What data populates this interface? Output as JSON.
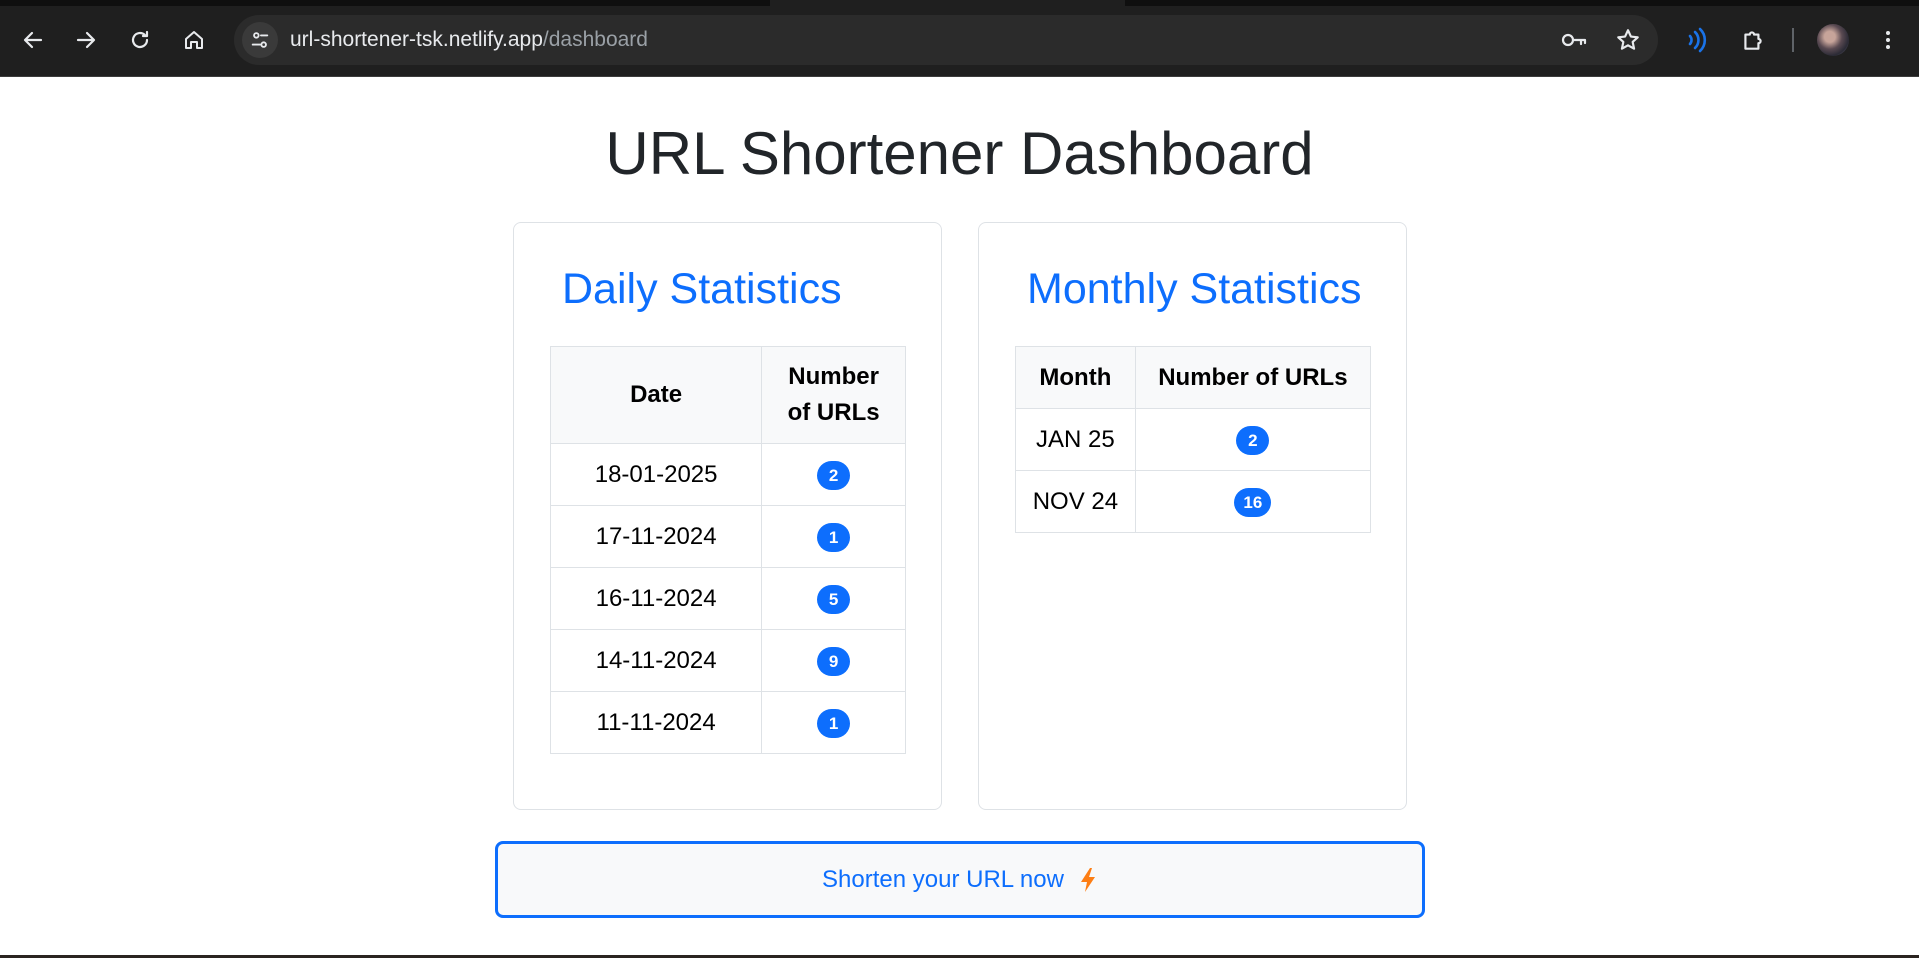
{
  "browser": {
    "url_host": "url-shortener-tsk.netlify.app",
    "url_path": "/dashboard",
    "icons": {
      "back": "arrow-left-icon",
      "forward": "arrow-right-icon",
      "reload": "reload-icon",
      "home": "home-icon",
      "site_info": "tune-icon",
      "password": "key-icon",
      "bookmark": "star-icon",
      "media": "broadcast-icon",
      "extensions": "puzzle-icon",
      "menu": "kebab-menu-icon"
    },
    "colors": {
      "chrome_bg": "#1f1f1f",
      "omnibox_bg": "#2b2b2b",
      "media_accent": "#1a73e8"
    }
  },
  "page": {
    "title": "URL Shortener Dashboard",
    "daily": {
      "title": "Daily Statistics",
      "headers": [
        "Date",
        "Number of URLs"
      ],
      "rows": [
        {
          "date": "18-01-2025",
          "count": "2"
        },
        {
          "date": "17-11-2024",
          "count": "1"
        },
        {
          "date": "16-11-2024",
          "count": "5"
        },
        {
          "date": "14-11-2024",
          "count": "9"
        },
        {
          "date": "11-11-2024",
          "count": "1"
        }
      ]
    },
    "monthly": {
      "title": "Monthly Statistics",
      "headers": [
        "Month",
        "Number of URLs"
      ],
      "rows": [
        {
          "month": "JAN 25",
          "count": "2"
        },
        {
          "month": "NOV 24",
          "count": "16"
        }
      ]
    },
    "cta": {
      "label": "Shorten your URL now",
      "icon": "lightning-bolt-icon"
    },
    "colors": {
      "primary": "#0d6efd",
      "bolt": "#fd7e14",
      "border": "#dee2e6"
    }
  }
}
